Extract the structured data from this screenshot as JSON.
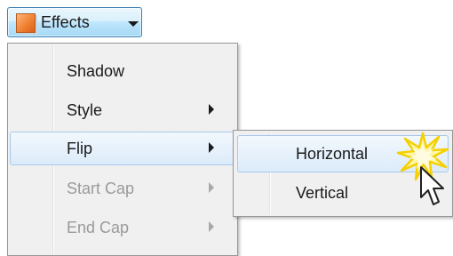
{
  "effects_button": {
    "label": "Effects",
    "icon": "effects-square-icon",
    "caret": "chevron-down-icon"
  },
  "menu": {
    "items": [
      {
        "label": "Shadow",
        "has_submenu": false,
        "enabled": true,
        "active": false
      },
      {
        "label": "Style",
        "has_submenu": true,
        "enabled": true,
        "active": false
      },
      {
        "label": "Flip",
        "has_submenu": true,
        "enabled": true,
        "active": true
      },
      {
        "label": "Start Cap",
        "has_submenu": true,
        "enabled": false,
        "active": false
      },
      {
        "label": "End Cap",
        "has_submenu": true,
        "enabled": false,
        "active": false
      }
    ]
  },
  "submenu": {
    "parent": "Flip",
    "items": [
      {
        "label": "Horizontal",
        "active": true
      },
      {
        "label": "Vertical",
        "active": false
      }
    ]
  },
  "colors": {
    "button_border": "#3c7fb1",
    "icon_orange": "#f08232",
    "highlight_border": "#a7c8ec",
    "disabled_text": "#9a9a9a",
    "burst_yellow": "#f5d000"
  }
}
